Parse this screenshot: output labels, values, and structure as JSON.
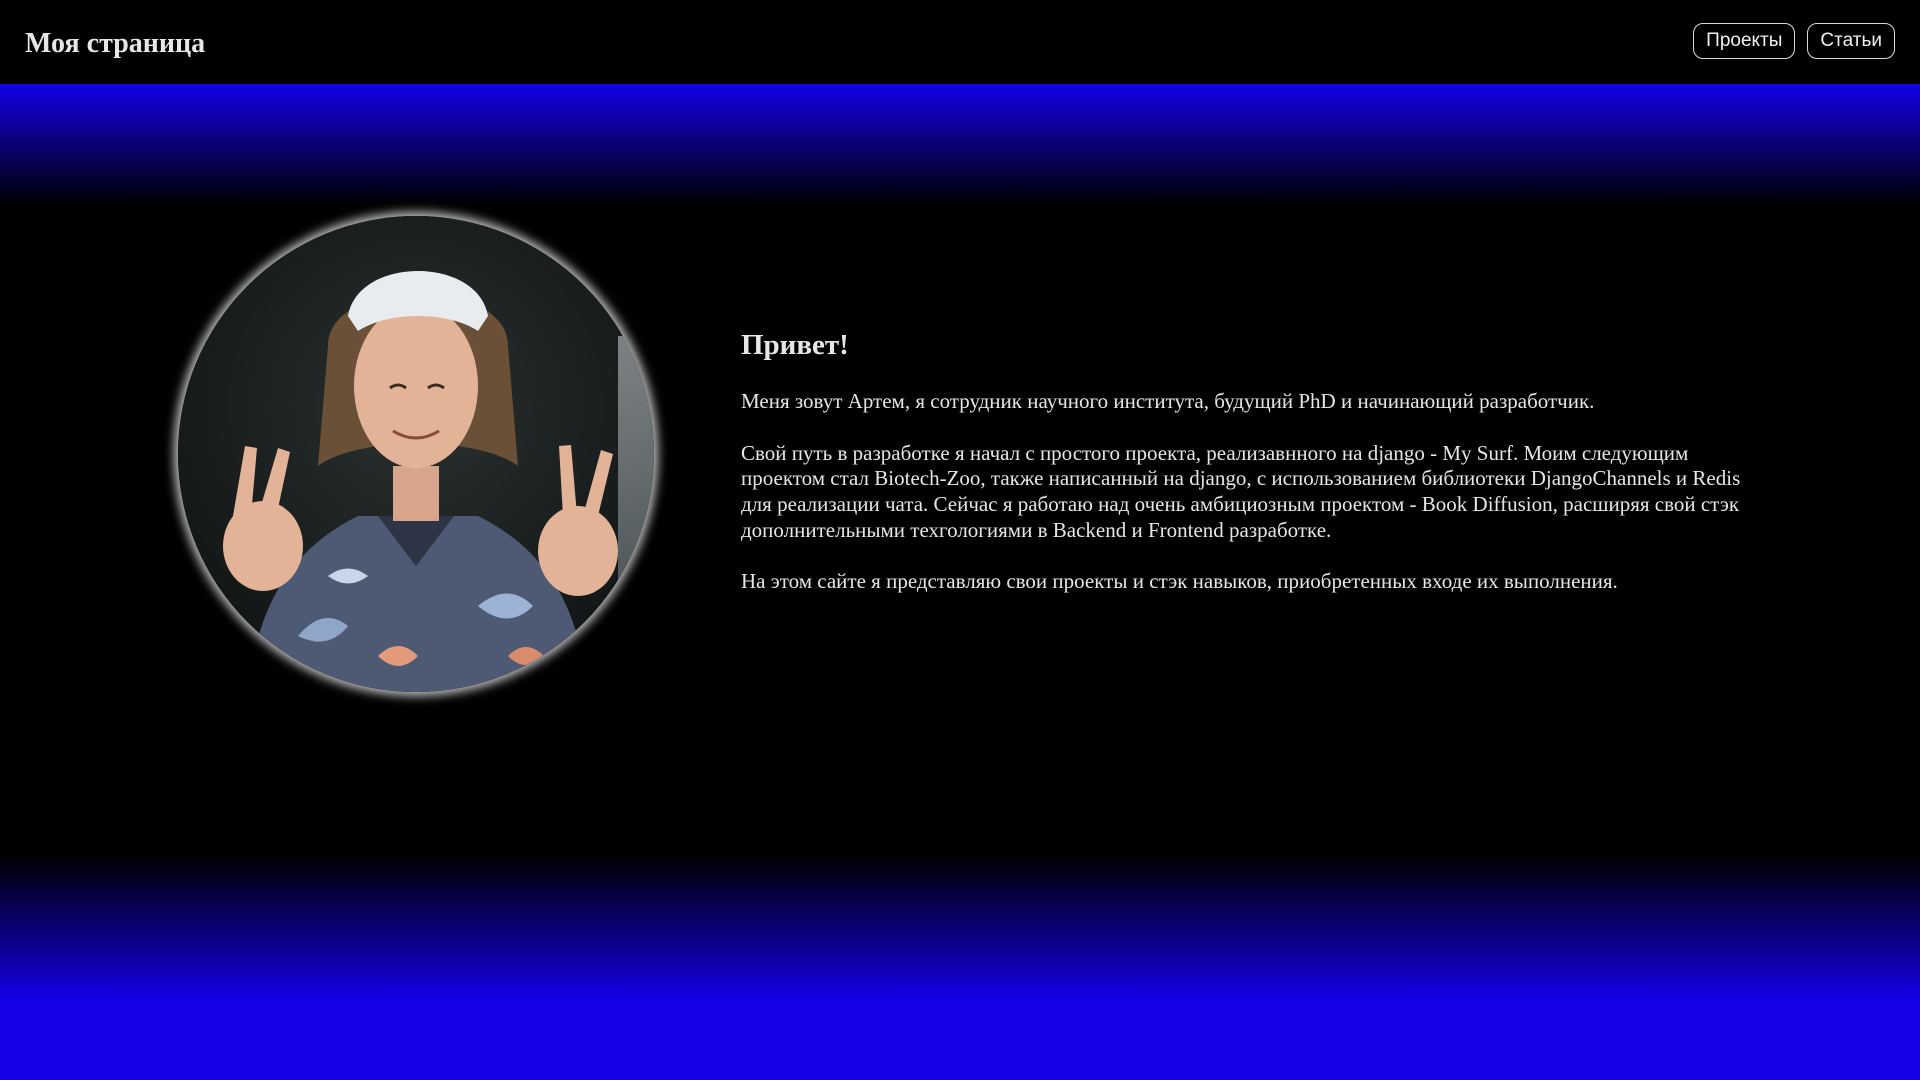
{
  "header": {
    "title": "Моя страница",
    "nav": [
      "Проекты",
      "Статьи"
    ]
  },
  "avatar": {
    "icon": "profile-photo"
  },
  "about": {
    "greeting": "Привет!",
    "paragraphs": [
      "Меня зовут Артем, я сотрудник научного института, будущий PhD и начинающий разработчик.",
      "Свой путь в разработке я начал с простого проекта, реализавнного на django - My Surf. Моим следующим проектом стал Biotech-Zoo, также написанный на django, с использованием библиотеки DjangoChannels и Redis для реализации чата. Сейчас я работаю над очень амбициозным проектом - Book Diffusion, расширяя свой стэк дополнительными техгологиями в Backend и Frontend разработке.",
      "На этом сайте я представляю свои проекты и стэк навыков, приобретенных входе их выполнения."
    ]
  },
  "colors": {
    "accent_blue": "#1300e6",
    "background": "#000000",
    "text": "#e6e6e6"
  }
}
